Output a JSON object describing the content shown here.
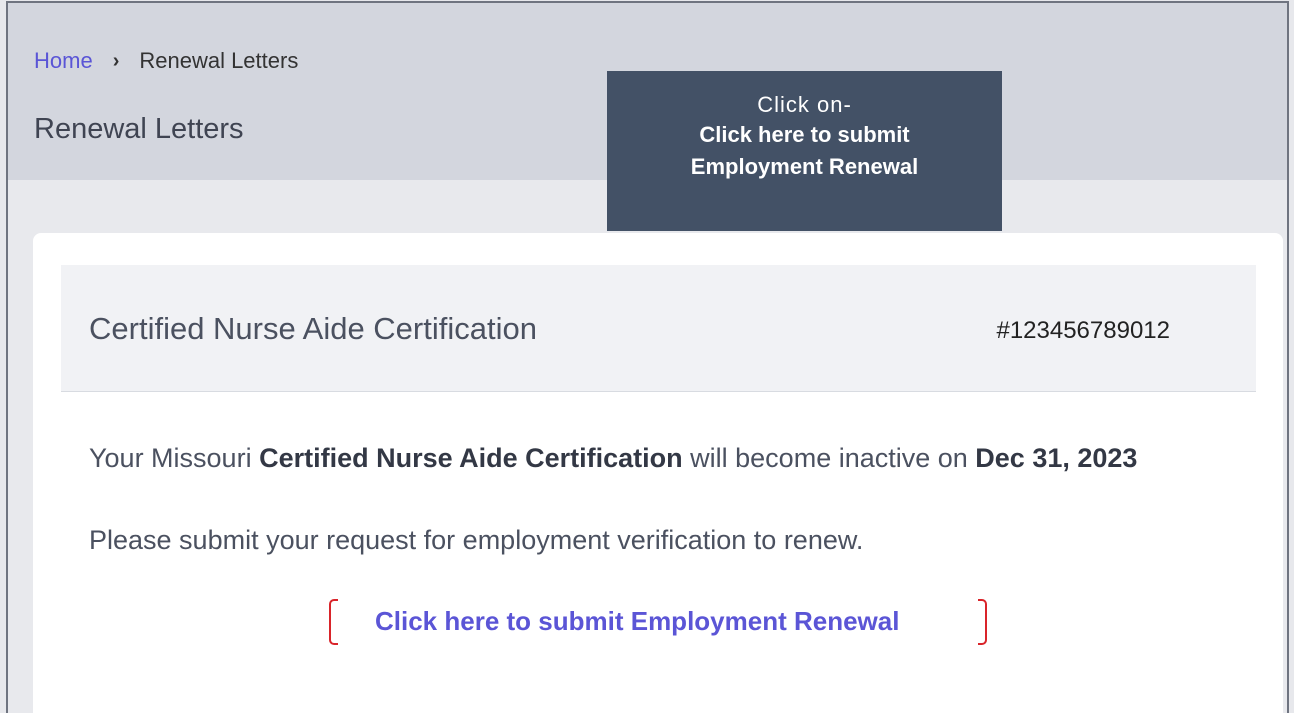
{
  "breadcrumb": {
    "home": "Home",
    "separator": "›",
    "current": "Renewal Letters"
  },
  "page": {
    "title": "Renewal Letters"
  },
  "callout": {
    "line1": "Click on-",
    "line2": "Click here to submit",
    "line3": "Employment Renewal"
  },
  "card": {
    "cert_title": "Certified Nurse Aide Certification",
    "cert_number": "#123456789012",
    "msg_prefix": "Your Missouri ",
    "msg_cert": "Certified Nurse Aide Certification",
    "msg_middle": " will become inactive on ",
    "msg_date": "Dec 31, 2023",
    "instruction": "Please submit your request for employment verification to renew.",
    "link_label": "Click here to submit Employment Renewal"
  },
  "colors": {
    "link": "#5b55d6",
    "callout_bg": "#435166",
    "highlight_bracket": "#d9242a",
    "header_band": "#d3d6de"
  }
}
